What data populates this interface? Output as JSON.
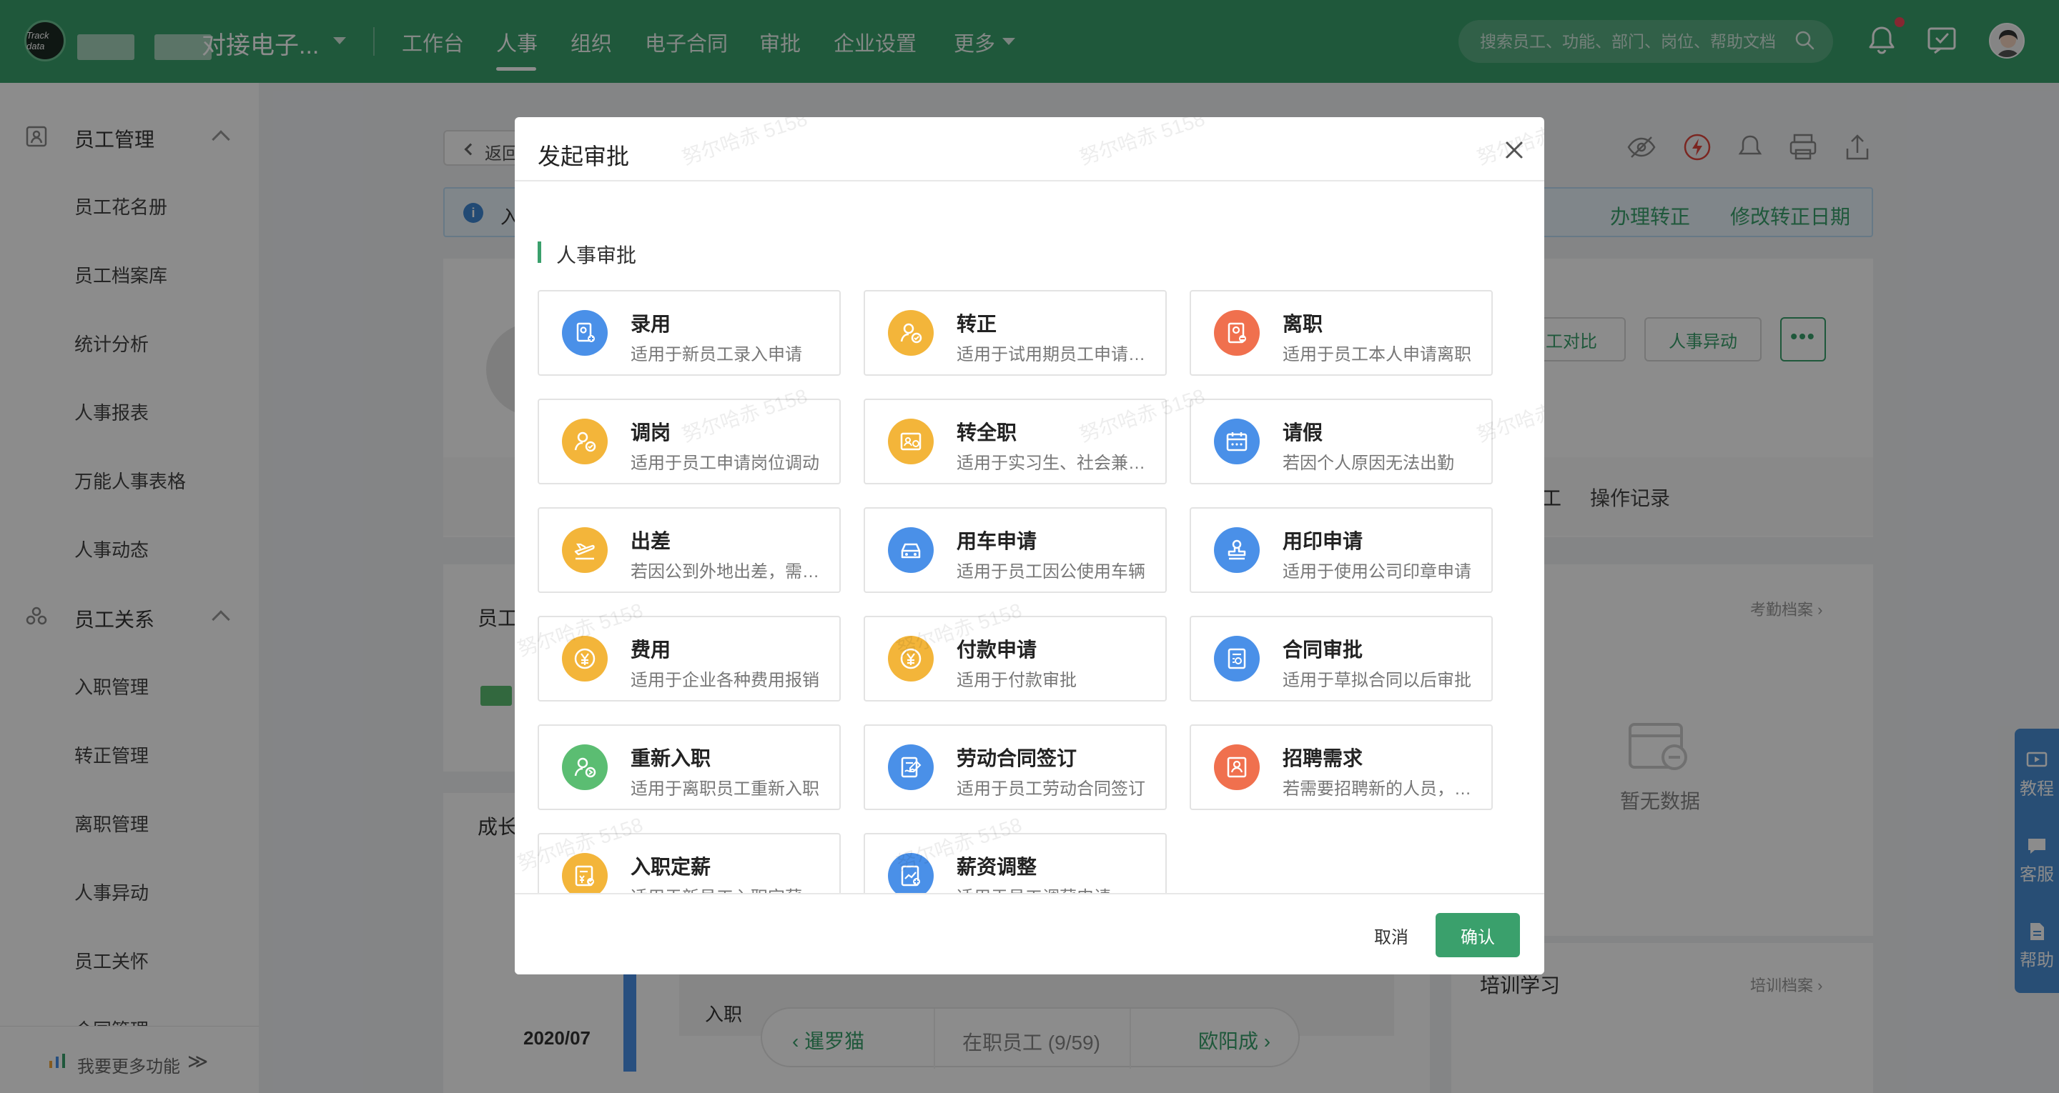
{
  "topbar": {
    "company_name": "对接电子...",
    "nav": [
      "工作台",
      "人事",
      "组织",
      "电子合同",
      "审批",
      "企业设置",
      "更多"
    ],
    "active_nav": "人事",
    "search_placeholder": "搜索员工、功能、部门、岗位、帮助文档",
    "logo_text": "Track data",
    "brand_color": "#3aa06c",
    "icons": [
      "search-icon",
      "bell-icon",
      "task-icon",
      "avatar"
    ]
  },
  "sidebar": {
    "groups": [
      {
        "label": "员工管理",
        "icon": "person-card-icon",
        "items": [
          "员工花名册",
          "员工档案库",
          "统计分析",
          "人事报表",
          "万能人事表格",
          "人事动态"
        ]
      },
      {
        "label": "员工关系",
        "icon": "people-icon",
        "items": [
          "入职管理",
          "转正管理",
          "离职管理",
          "人事异动",
          "员工关怀",
          "合同管理"
        ]
      }
    ],
    "bottom_label": "我要更多功能",
    "bottom_arrows": "≫"
  },
  "background": {
    "back_label": "返回",
    "notice_text": "入",
    "notice_links": [
      "办理转正",
      "修改转正日期"
    ],
    "action_buttons": [
      "员工对比",
      "人事异动"
    ],
    "more_label": "•••",
    "tabs_right": [
      "工",
      "操作记录"
    ],
    "section_left_1": "员工",
    "section_left_2": "成长",
    "attendance_link": "考勤档案 ›",
    "empty_text": "暂无数据",
    "training_title": "培训学习",
    "training_link": "培训档案 ›",
    "timeline_year": "2020/07",
    "timeline_event": "入职",
    "float_items": [
      "教程",
      "客服",
      "帮助"
    ],
    "pager": {
      "prev": "暹罗猫",
      "middle": "在职员工 (9/59)",
      "next": "欧阳成"
    }
  },
  "modal": {
    "title": "发起审批",
    "section_title": "人事审批",
    "watermark": "努尔哈赤 5158",
    "tiles": [
      {
        "title": "录用",
        "desc": "适用于新员工录入申请",
        "color": "blue",
        "icon": "hire-icon"
      },
      {
        "title": "转正",
        "desc": "适用于试用期员工申请转正",
        "color": "yellow",
        "icon": "regularize-icon"
      },
      {
        "title": "离职",
        "desc": "适用于员工本人申请离职",
        "color": "orange",
        "icon": "resign-icon"
      },
      {
        "title": "调岗",
        "desc": "适用于员工申请岗位调动",
        "color": "yellow",
        "icon": "transfer-icon"
      },
      {
        "title": "转全职",
        "desc": "适用于实习生、社会兼职人员",
        "color": "yellow",
        "icon": "fulltime-icon"
      },
      {
        "title": "请假",
        "desc": "若因个人原因无法出勤",
        "color": "blue",
        "icon": "calendar-icon"
      },
      {
        "title": "出差",
        "desc": "若因公到外地出差，需申请",
        "color": "yellow",
        "icon": "plane-icon"
      },
      {
        "title": "用车申请",
        "desc": "适用于员工因公使用车辆",
        "color": "blue",
        "icon": "car-icon"
      },
      {
        "title": "用印申请",
        "desc": "适用于使用公司印章申请",
        "color": "blue",
        "icon": "stamp-icon"
      },
      {
        "title": "费用",
        "desc": "适用于企业各种费用报销",
        "color": "yellow",
        "icon": "yen-icon"
      },
      {
        "title": "付款申请",
        "desc": "适用于付款审批",
        "color": "yellow",
        "icon": "yen-icon"
      },
      {
        "title": "合同审批",
        "desc": "适用于草拟合同以后审批",
        "color": "blue",
        "icon": "contract-icon"
      },
      {
        "title": "重新入职",
        "desc": "适用于离职员工重新入职",
        "color": "green",
        "icon": "rehire-icon"
      },
      {
        "title": "劳动合同签订",
        "desc": "适用于员工劳动合同签订",
        "color": "blue",
        "icon": "sign-icon"
      },
      {
        "title": "招聘需求",
        "desc": "若需要招聘新的人员，需申请",
        "color": "orange",
        "icon": "recruit-icon"
      },
      {
        "title": "入职定薪",
        "desc": "适用于新员工入职定薪",
        "color": "yellow",
        "icon": "salary-icon"
      },
      {
        "title": "薪资调整",
        "desc": "适用于员工调薪申请",
        "color": "blue",
        "icon": "salary-adjust-icon"
      }
    ],
    "cancel_label": "取消",
    "ok_label": "确认"
  }
}
